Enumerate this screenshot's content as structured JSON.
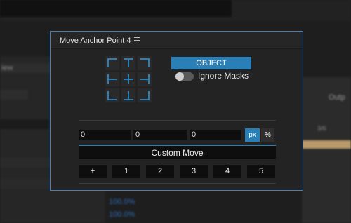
{
  "panel": {
    "title": "Move Anchor Point 4",
    "object_button": "OBJECT",
    "ignore_masks_label": "Ignore Masks",
    "ignore_masks_on": false,
    "coords": [
      "0",
      "0",
      "0"
    ],
    "units": [
      "px",
      "%"
    ],
    "active_unit": "px",
    "custom_move_label": "Custom Move",
    "move_buttons": [
      "+",
      "1",
      "2",
      "3",
      "4",
      "5"
    ]
  },
  "background": {
    "view_text": "iew",
    "right_text": "Outp",
    "small_right": "3/6",
    "percent_values": [
      "100.0%",
      "100.0%"
    ]
  },
  "colors": {
    "accent": "#2a7fb6",
    "panel_border": "#4a7fb5",
    "panel_bg": "#232323",
    "field_bg": "#0e0e0e"
  }
}
